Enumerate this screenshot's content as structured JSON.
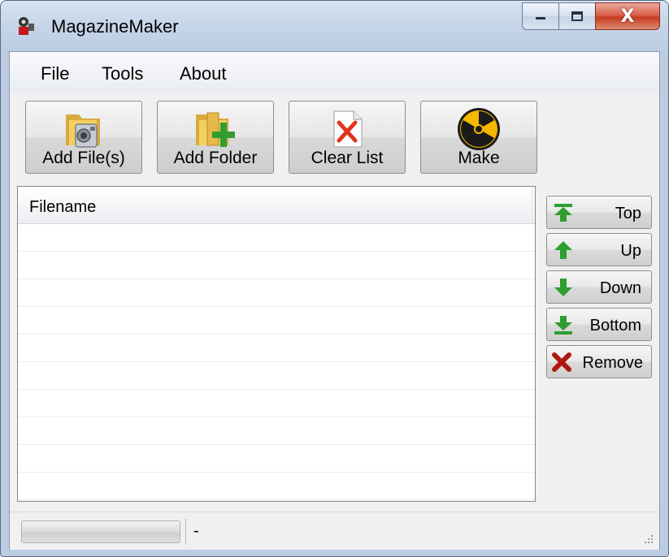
{
  "window": {
    "title": "MagazineMaker"
  },
  "menu": {
    "items": [
      "File",
      "Tools",
      "About"
    ]
  },
  "toolbar": {
    "buttons": [
      {
        "label": "Add File(s)",
        "icon": "add-files-icon"
      },
      {
        "label": "Add Folder",
        "icon": "add-folder-icon"
      },
      {
        "label": "Clear List",
        "icon": "clear-list-icon"
      },
      {
        "label": "Make",
        "icon": "radiation-icon"
      }
    ]
  },
  "list": {
    "columns": [
      "Filename"
    ],
    "rows": []
  },
  "side_buttons": [
    {
      "label": "Top",
      "icon": "move-top-icon"
    },
    {
      "label": "Up",
      "icon": "move-up-icon"
    },
    {
      "label": "Down",
      "icon": "move-down-icon"
    },
    {
      "label": "Bottom",
      "icon": "move-bottom-icon"
    },
    {
      "label": "Remove",
      "icon": "remove-icon"
    }
  ],
  "status": {
    "text": "-",
    "progress": 0
  },
  "colors": {
    "accent_green": "#2f9d2f",
    "close_red": "#c63b22",
    "radiation_yellow": "#f5b800"
  }
}
